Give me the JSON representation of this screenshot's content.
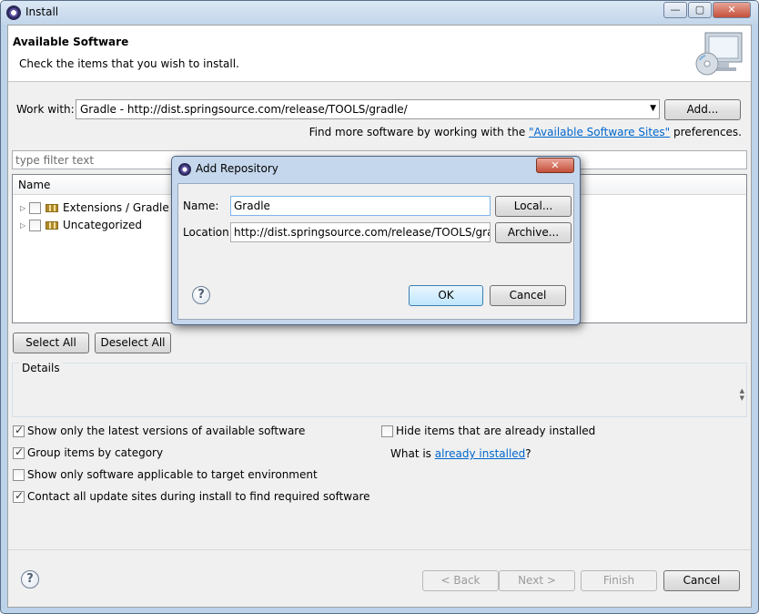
{
  "window": {
    "title": "Install",
    "controls": {
      "minimize": "—",
      "maximize": "▢",
      "close": "✕"
    }
  },
  "banner": {
    "title": "Available Software",
    "subtitle": "Check the items that you wish to install.",
    "icon": "install-monitor-cd-icon"
  },
  "work_with": {
    "label": "Work with:",
    "value": "Gradle - http://dist.springsource.com/release/TOOLS/gradle/",
    "add_button": "Add..."
  },
  "find_more": {
    "prefix": "Find more software by working with the ",
    "link": "\"Available Software Sites\"",
    "suffix": " preferences."
  },
  "filter": {
    "placeholder": "type filter text"
  },
  "tree": {
    "column_name": "Name",
    "items": [
      {
        "label": "Extensions / Gradle In",
        "checked": false
      },
      {
        "label": "Uncategorized",
        "checked": false
      }
    ]
  },
  "selection_buttons": {
    "select_all": "Select All",
    "deselect_all": "Deselect All"
  },
  "details": {
    "label": "Details"
  },
  "options": {
    "latest_versions": {
      "label": "Show only the latest versions of available software",
      "checked": true
    },
    "group_by_category": {
      "label": "Group items by category",
      "checked": true
    },
    "target_env": {
      "label": "Show only software applicable to target environment",
      "checked": false
    },
    "contact_sites": {
      "label": "Contact all update sites during install to find required software",
      "checked": true
    },
    "hide_installed": {
      "label": "Hide items that are already installed",
      "checked": false
    },
    "what_is": {
      "prefix": "What is ",
      "link": "already installed",
      "suffix": "?"
    }
  },
  "footer": {
    "back": "< Back",
    "next": "Next >",
    "finish": "Finish",
    "cancel": "Cancel"
  },
  "dialog": {
    "title": "Add Repository",
    "name_label": "Name:",
    "name_value": "Gradle",
    "location_label": "Location:",
    "location_value": "http://dist.springsource.com/release/TOOLS/gradle/",
    "local_button": "Local...",
    "archive_button": "Archive...",
    "ok_button": "OK",
    "cancel_button": "Cancel",
    "close": "✕"
  },
  "help_glyph": "?"
}
